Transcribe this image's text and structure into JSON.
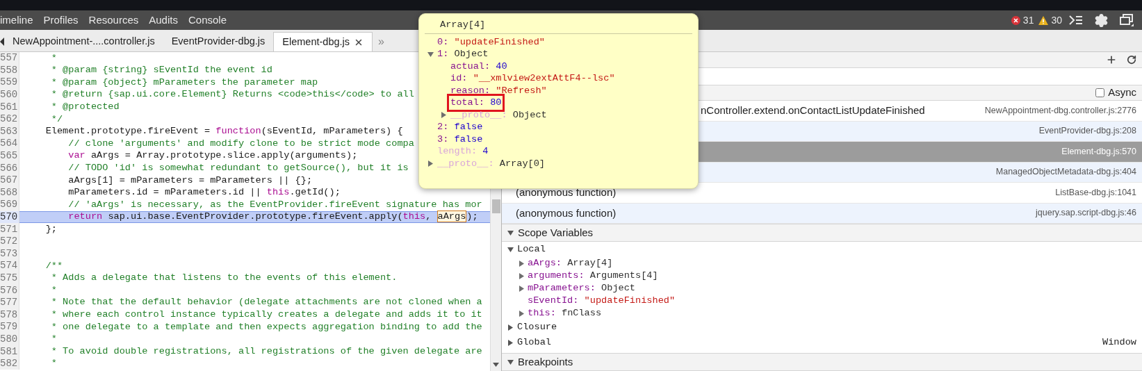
{
  "toolbar": {
    "tabs": [
      {
        "label": "imeline",
        "selected": false
      },
      {
        "label": "Profiles",
        "selected": false
      },
      {
        "label": "Resources",
        "selected": false
      },
      {
        "label": "Audits",
        "selected": false
      },
      {
        "label": "Console",
        "selected": false
      }
    ],
    "errors": "31",
    "warnings": "30"
  },
  "file_tabs": {
    "items": [
      {
        "label": "NewAppointment-....controller.js",
        "selected": false
      },
      {
        "label": "EventProvider-dbg.js",
        "selected": false
      },
      {
        "label": "Element-dbg.js",
        "selected": true,
        "closable": true
      }
    ],
    "overflow": "»"
  },
  "code": {
    "lines": [
      {
        "number": "557",
        "current": false,
        "segments": [
          {
            "kind": "comment",
            "text": "     *"
          }
        ]
      },
      {
        "number": "558",
        "current": false,
        "segments": [
          {
            "kind": "comment",
            "text": "     * @param {string} sEventId the event id"
          }
        ]
      },
      {
        "number": "559",
        "current": false,
        "segments": [
          {
            "kind": "comment",
            "text": "     * @param {object} mParameters the parameter map"
          }
        ]
      },
      {
        "number": "560",
        "current": false,
        "segments": [
          {
            "kind": "comment",
            "text": "     * @return {sap.ui.core.Element} Returns <code>this</code> to all"
          }
        ]
      },
      {
        "number": "561",
        "current": false,
        "segments": [
          {
            "kind": "comment",
            "text": "     * @protected"
          }
        ]
      },
      {
        "number": "562",
        "current": false,
        "segments": [
          {
            "kind": "comment",
            "text": "     */"
          }
        ]
      },
      {
        "number": "563",
        "current": false,
        "segments": [
          {
            "kind": "plain",
            "text": "    Element.prototype.fireEvent = "
          },
          {
            "kind": "keyword",
            "text": "function"
          },
          {
            "kind": "plain",
            "text": "(sEventId, mParameters) {"
          }
        ]
      },
      {
        "number": "564",
        "current": false,
        "segments": [
          {
            "kind": "comment",
            "text": "        // clone 'arguments' and modify clone to be strict mode compa"
          }
        ]
      },
      {
        "number": "565",
        "current": false,
        "segments": [
          {
            "kind": "keyword",
            "text": "        var"
          },
          {
            "kind": "plain",
            "text": " aArgs = Array.prototype.slice.apply(arguments);"
          }
        ]
      },
      {
        "number": "566",
        "current": false,
        "segments": [
          {
            "kind": "comment",
            "text": "        // TODO 'id' is somewhat redundant to getSource(), but it is"
          }
        ]
      },
      {
        "number": "567",
        "current": false,
        "segments": [
          {
            "kind": "plain",
            "text": "        aArgs[1] = mParameters = mParameters || {};"
          }
        ]
      },
      {
        "number": "568",
        "current": false,
        "segments": [
          {
            "kind": "plain",
            "text": "        mParameters.id = mParameters.id || "
          },
          {
            "kind": "keyword",
            "text": "this"
          },
          {
            "kind": "plain",
            "text": ".getId();"
          }
        ]
      },
      {
        "number": "569",
        "current": false,
        "segments": [
          {
            "kind": "comment",
            "text": "        // 'aArgs' is necessary, as the EventProvider.fireEvent signature has mor"
          }
        ]
      },
      {
        "number": "570",
        "current": true,
        "segments": [
          {
            "kind": "keyword",
            "text": "        return"
          },
          {
            "kind": "plain",
            "text": " sap.ui.base.EventProvider.prototype.fireEvent.apply("
          },
          {
            "kind": "keyword",
            "text": "this"
          },
          {
            "kind": "plain",
            "text": ", "
          },
          {
            "kind": "hover",
            "text": "aArgs"
          },
          {
            "kind": "plain",
            "text": ");"
          }
        ]
      },
      {
        "number": "571",
        "current": false,
        "segments": [
          {
            "kind": "plain",
            "text": "    };"
          }
        ]
      },
      {
        "number": "572",
        "current": false
      },
      {
        "number": "573",
        "current": false
      },
      {
        "number": "574",
        "current": false,
        "segments": [
          {
            "kind": "comment",
            "text": "    /**"
          }
        ]
      },
      {
        "number": "575",
        "current": false,
        "segments": [
          {
            "kind": "comment",
            "text": "     * Adds a delegate that listens to the events of this element."
          }
        ]
      },
      {
        "number": "576",
        "current": false,
        "segments": [
          {
            "kind": "comment",
            "text": "     *"
          }
        ]
      },
      {
        "number": "577",
        "current": false,
        "segments": [
          {
            "kind": "comment",
            "text": "     * Note that the default behavior (delegate attachments are not cloned when a"
          }
        ]
      },
      {
        "number": "578",
        "current": false,
        "segments": [
          {
            "kind": "comment",
            "text": "     * where each control instance typically creates a delegate and adds it to it"
          }
        ]
      },
      {
        "number": "579",
        "current": false,
        "segments": [
          {
            "kind": "comment",
            "text": "     * one delegate to a template and then expects aggregation binding to add the"
          }
        ]
      },
      {
        "number": "580",
        "current": false,
        "segments": [
          {
            "kind": "comment",
            "text": "     *"
          }
        ]
      },
      {
        "number": "581",
        "current": false,
        "segments": [
          {
            "kind": "comment",
            "text": "     * To avoid double registrations, all registrations of the given delegate are"
          }
        ]
      },
      {
        "number": "582",
        "current": false,
        "segments": [
          {
            "kind": "comment",
            "text": "     *"
          }
        ]
      }
    ]
  },
  "popover": {
    "title": "Array[4]",
    "entries": [
      {
        "key": "0:",
        "value": "\"updateFinished\"",
        "kind": "string",
        "enumerable": true,
        "highlighted": false
      },
      {
        "key": "1:",
        "value": "Object",
        "kind": "object",
        "expanded": true,
        "enumerable": true,
        "highlighted": false,
        "children": [
          {
            "key": "actual:",
            "value": "40",
            "kind": "number",
            "enumerable": true,
            "highlighted": false
          },
          {
            "key": "id:",
            "value": "\"__xmlview2extAttF4--lsc\"",
            "kind": "string",
            "enumerable": true,
            "highlighted": false
          },
          {
            "key": "reason:",
            "value": "\"Refresh\"",
            "kind": "string",
            "enumerable": true,
            "highlighted": false
          },
          {
            "key": "total:",
            "value": "80",
            "kind": "number",
            "enumerable": true,
            "highlighted": true
          },
          {
            "key": "__proto__:",
            "value": "Object",
            "kind": "object",
            "expanded": false,
            "enumerable": false,
            "highlighted": false
          }
        ]
      },
      {
        "key": "2:",
        "value": "false",
        "kind": "number",
        "enumerable": true,
        "highlighted": false
      },
      {
        "key": "3:",
        "value": "false",
        "kind": "number",
        "enumerable": true,
        "highlighted": false
      },
      {
        "key": "length:",
        "value": "4",
        "kind": "number",
        "enumerable": false,
        "highlighted": false
      },
      {
        "key": "__proto__:",
        "value": "Array[0]",
        "kind": "object",
        "expanded": false,
        "enumerable": false,
        "highlighted": false
      }
    ]
  },
  "call_stack": {
    "async": {
      "label": "Async",
      "checked": false
    },
    "frames": [
      {
        "kind": "cut",
        "name": "nController.extend.onContactListUpdateFinished",
        "location": "NewAppointment-dbg.controller.js:2776",
        "selected": false
      },
      {
        "kind": "hidden",
        "location": "EventProvider-dbg.js:208",
        "selected": false
      },
      {
        "kind": "hidden",
        "location": "Element-dbg.js:570",
        "selected": true
      },
      {
        "kind": "hidden",
        "location": "ManagedObjectMetadata-dbg.js:404",
        "selected": false
      },
      {
        "kind": "full",
        "name": "(anonymous function)",
        "location": "ListBase-dbg.js:1041",
        "selected": false
      },
      {
        "kind": "full",
        "name": "(anonymous function)",
        "location": "jquery.sap.script-dbg.js:46",
        "selected": false
      }
    ]
  },
  "scope": {
    "title": "Scope Variables",
    "expanded": true,
    "groups": [
      {
        "name": "Local",
        "expanded": true,
        "variables": [
          {
            "name": "aArgs:",
            "value": "Array[4]",
            "kind": "object",
            "expandable": true
          },
          {
            "name": "arguments:",
            "value": "Arguments[4]",
            "kind": "object",
            "expandable": true
          },
          {
            "name": "mParameters:",
            "value": "Object",
            "kind": "object",
            "expandable": true
          },
          {
            "name": "sEventId:",
            "value": "\"updateFinished\"",
            "kind": "string",
            "expandable": false
          },
          {
            "name": "this:",
            "value": "fnClass",
            "kind": "object",
            "expandable": true
          }
        ]
      },
      {
        "name": "Closure",
        "expanded": false
      },
      {
        "name": "Global",
        "expanded": false,
        "value": "Window"
      }
    ]
  },
  "breakpoints": {
    "title": "Breakpoints",
    "expanded": true
  }
}
